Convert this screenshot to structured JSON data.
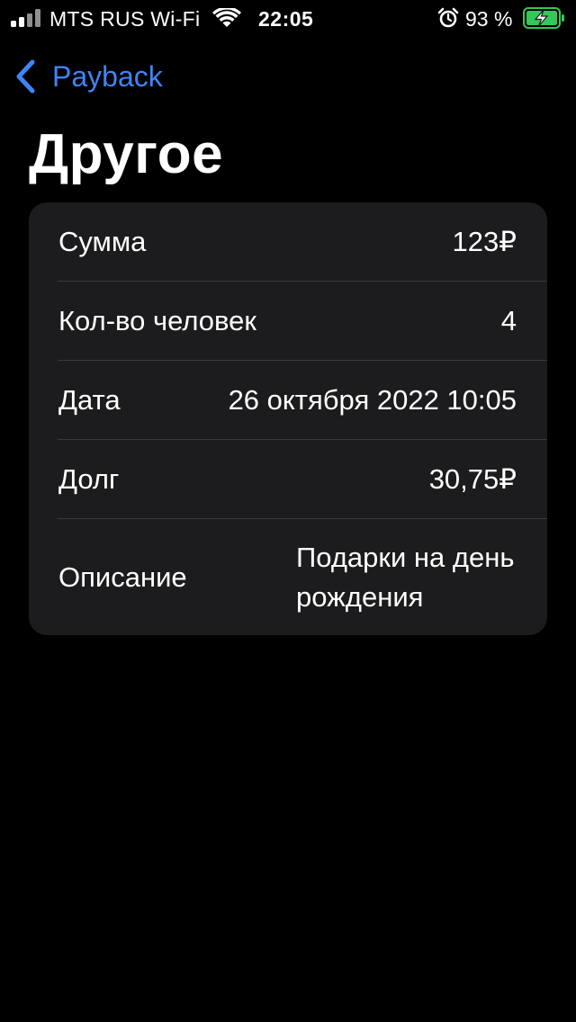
{
  "status_bar": {
    "carrier": "MTS RUS Wi-Fi",
    "time": "22:05",
    "battery_percent": "93 %",
    "icons": [
      "signal-icon",
      "wifi-icon",
      "alarm-icon",
      "battery-charging-icon"
    ]
  },
  "nav": {
    "back_label": "Payback"
  },
  "page": {
    "title": "Другое"
  },
  "details": {
    "rows": [
      {
        "label": "Сумма",
        "value": "123₽"
      },
      {
        "label": "Кол-во человек",
        "value": "4"
      },
      {
        "label": "Дата",
        "value": "26 октября 2022 10:05"
      },
      {
        "label": "Долг",
        "value": "30,75₽"
      },
      {
        "label": "Описание",
        "value": "Подарки на день рождения"
      }
    ]
  },
  "colors": {
    "background": "#000000",
    "card": "#1c1c1e",
    "accent": "#3f85f7",
    "battery_charging": "#34c759",
    "divider": "#3a3a3c"
  }
}
